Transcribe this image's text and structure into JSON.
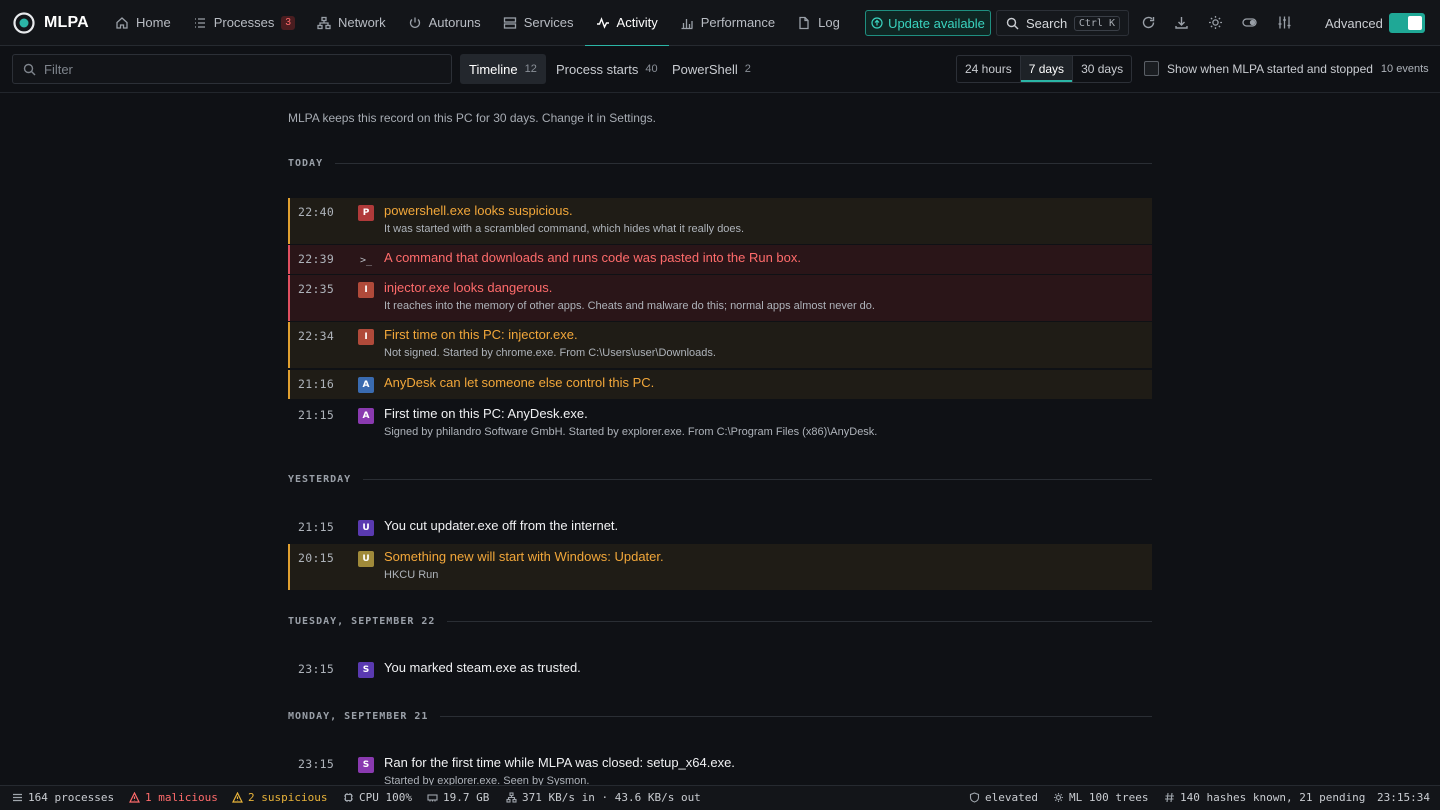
{
  "app": {
    "name": "MLPA"
  },
  "nav": {
    "home": "Home",
    "processes": "Processes",
    "processes_badge": "3",
    "network": "Network",
    "autoruns": "Autoruns",
    "services": "Services",
    "activity": "Activity",
    "performance": "Performance",
    "log": "Log"
  },
  "header": {
    "update_label": "Update available",
    "search_label": "Search",
    "search_shortcut": "Ctrl K",
    "advanced_label": "Advanced",
    "advanced_on": true
  },
  "toolbar": {
    "filter_placeholder": "Filter",
    "filter_value": "",
    "view_tabs": [
      {
        "label": "Timeline",
        "count": "12",
        "active": true
      },
      {
        "label": "Process starts",
        "count": "40",
        "active": false
      },
      {
        "label": "PowerShell",
        "count": "2",
        "active": false
      }
    ],
    "ranges": [
      {
        "label": "24 hours",
        "active": false
      },
      {
        "label": "7 days",
        "active": true
      },
      {
        "label": "30 days",
        "active": false
      }
    ],
    "show_started_stopped_label": "Show when MLPA started and stopped",
    "show_started_stopped_checked": false,
    "events_count": "10 events"
  },
  "retention_note": "MLPA keeps this record on this PC for 30 days. Change it in Settings.",
  "days": [
    {
      "label": "TODAY",
      "events": [
        {
          "time": "22:40",
          "severity": "warn",
          "icon_letter": "P",
          "icon_color": "#b03a3a",
          "title": "powershell.exe looks suspicious.",
          "detail": "It was started with a scrambled command, which hides what it really does."
        },
        {
          "time": "22:39",
          "severity": "danger",
          "icon_letter": ">_",
          "icon_color": "",
          "title": "A command that downloads and runs code was pasted into the Run box.",
          "detail": ""
        },
        {
          "time": "22:35",
          "severity": "danger",
          "icon_letter": "I",
          "icon_color": "#b04a3a",
          "title": "injector.exe looks dangerous.",
          "detail": "It reaches into the memory of other apps. Cheats and malware do this; normal apps almost never do."
        },
        {
          "time": "22:34",
          "severity": "warn",
          "icon_letter": "I",
          "icon_color": "#b04a3a",
          "title": "First time on this PC: injector.exe.",
          "detail": "Not signed. Started by chrome.exe. From C:\\Users\\user\\Downloads."
        },
        {
          "time": "21:16",
          "severity": "warn",
          "icon_letter": "A",
          "icon_color": "#3a6bb0",
          "title": "AnyDesk can let someone else control this PC.",
          "detail": ""
        },
        {
          "time": "21:15",
          "severity": "plain",
          "icon_letter": "A",
          "icon_color": "#8a3ab0",
          "title": "First time on this PC: AnyDesk.exe.",
          "detail": "Signed by philandro Software GmbH. Started by explorer.exe. From C:\\Program Files (x86)\\AnyDesk."
        }
      ]
    },
    {
      "label": "YESTERDAY",
      "events": [
        {
          "time": "21:15",
          "severity": "plain",
          "icon_letter": "U",
          "icon_color": "#5a3ab0",
          "title": "You cut updater.exe off from the internet.",
          "detail": ""
        },
        {
          "time": "20:15",
          "severity": "warn",
          "icon_letter": "U",
          "icon_color": "#a08a3a",
          "title": "Something new will start with Windows: Updater.",
          "detail": "HKCU Run"
        }
      ]
    },
    {
      "label": "TUESDAY, SEPTEMBER 22",
      "events": [
        {
          "time": "23:15",
          "severity": "plain",
          "icon_letter": "S",
          "icon_color": "#5a3ab0",
          "title": "You marked steam.exe as trusted.",
          "detail": ""
        }
      ]
    },
    {
      "label": "MONDAY, SEPTEMBER 21",
      "events": [
        {
          "time": "23:15",
          "severity": "plain",
          "icon_letter": "S",
          "icon_color": "#8a3ab0",
          "title": "Ran for the first time while MLPA was closed: setup_x64.exe.",
          "detail": "Started by explorer.exe. Seen by Sysmon."
        }
      ]
    }
  ],
  "status": {
    "processes": "164 processes",
    "malicious": "1 malicious",
    "suspicious": "2 suspicious",
    "cpu": "CPU 100%",
    "memory": "19.7 GB",
    "network": "371 KB/s in · 43.6 KB/s out",
    "elevated": "elevated",
    "ml": "ML 100 trees",
    "hashes": "140 hashes known, 21 pending",
    "clock": "23:15:34"
  },
  "colors": {
    "accent": "#2bb5a6",
    "warn": "#f2a73a",
    "danger": "#ff6b6b"
  }
}
